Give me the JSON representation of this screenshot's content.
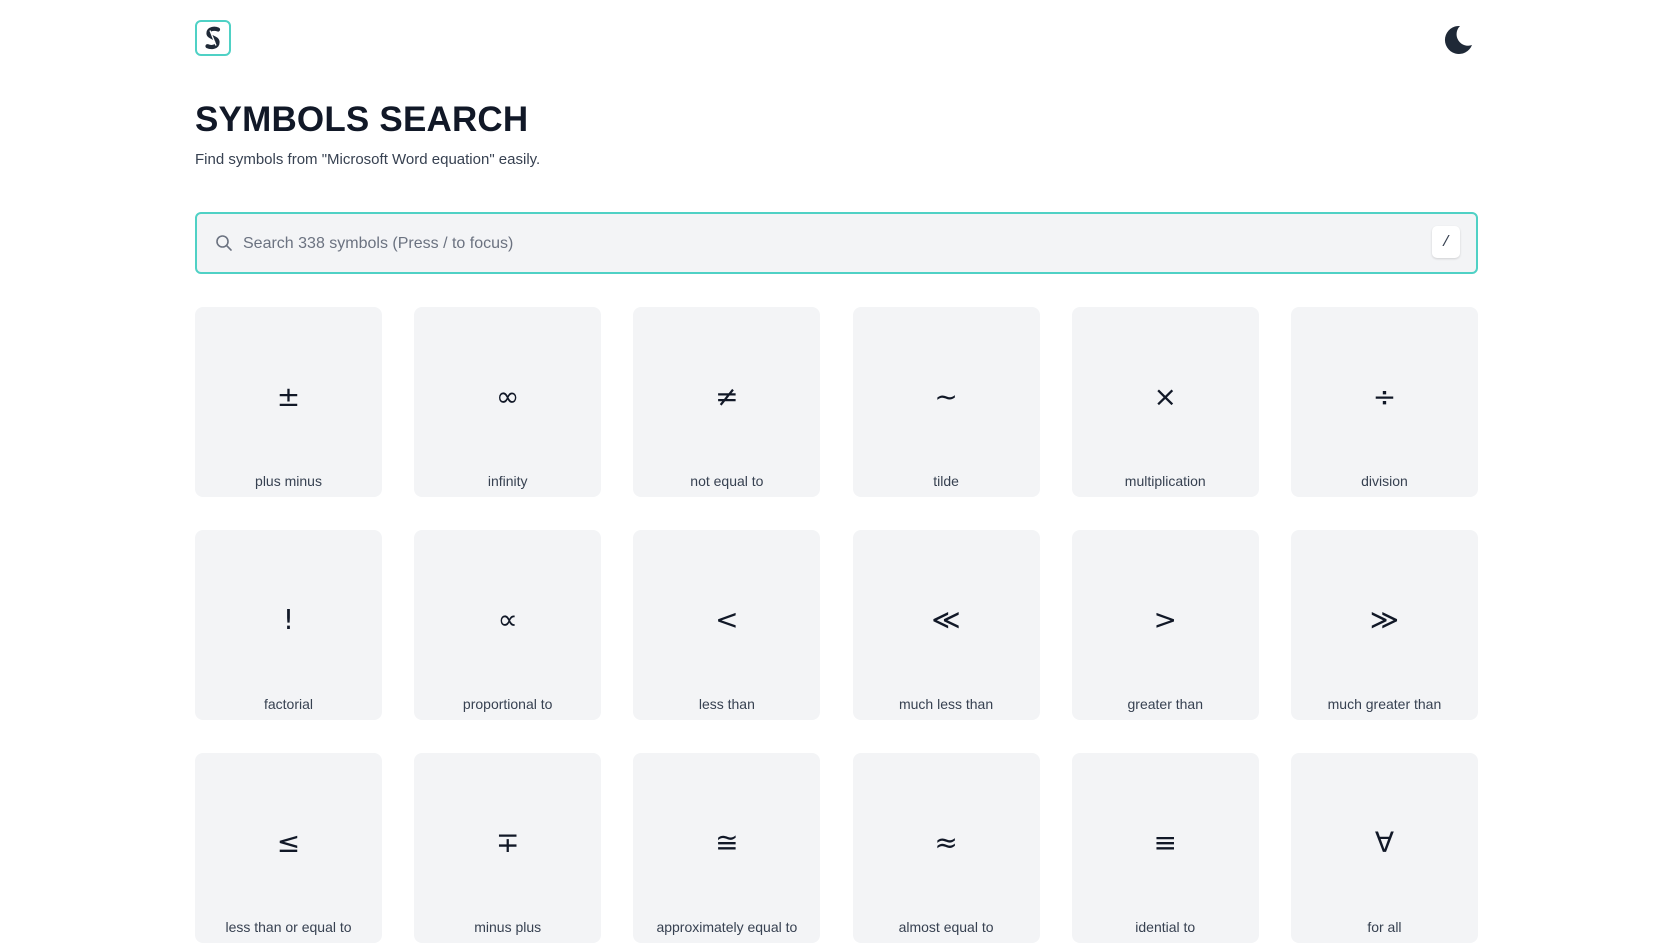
{
  "header": {
    "logo_letter": "S",
    "theme_toggle_icon": "moon-icon"
  },
  "title": "SYMBOLS SEARCH",
  "subtitle": "Find symbols from \"Microsoft Word equation\" easily.",
  "search": {
    "placeholder": "Search 338 symbols (Press / to focus)",
    "value": "",
    "shortcut_key": "/"
  },
  "colors": {
    "accent": "#4fd1c5",
    "card_bg": "#f3f4f6",
    "text": "#111827"
  },
  "symbols": [
    {
      "symbol": "±",
      "label": "plus minus"
    },
    {
      "symbol": "∞",
      "label": "infinity"
    },
    {
      "symbol": "≠",
      "label": "not equal to"
    },
    {
      "symbol": "~",
      "label": "tilde"
    },
    {
      "symbol": "×",
      "label": "multiplication"
    },
    {
      "symbol": "÷",
      "label": "division"
    },
    {
      "symbol": "!",
      "label": "factorial"
    },
    {
      "symbol": "∝",
      "label": "proportional to"
    },
    {
      "symbol": "<",
      "label": "less than"
    },
    {
      "symbol": "≪",
      "label": "much less than"
    },
    {
      "symbol": ">",
      "label": "greater than"
    },
    {
      "symbol": "≫",
      "label": "much greater than"
    },
    {
      "symbol": "≤",
      "label": "less than or equal to"
    },
    {
      "symbol": "∓",
      "label": "minus plus"
    },
    {
      "symbol": "≅",
      "label": "approximately equal to"
    },
    {
      "symbol": "≈",
      "label": "almost equal to"
    },
    {
      "symbol": "≡",
      "label": "idential to"
    },
    {
      "symbol": "∀",
      "label": "for all"
    }
  ]
}
